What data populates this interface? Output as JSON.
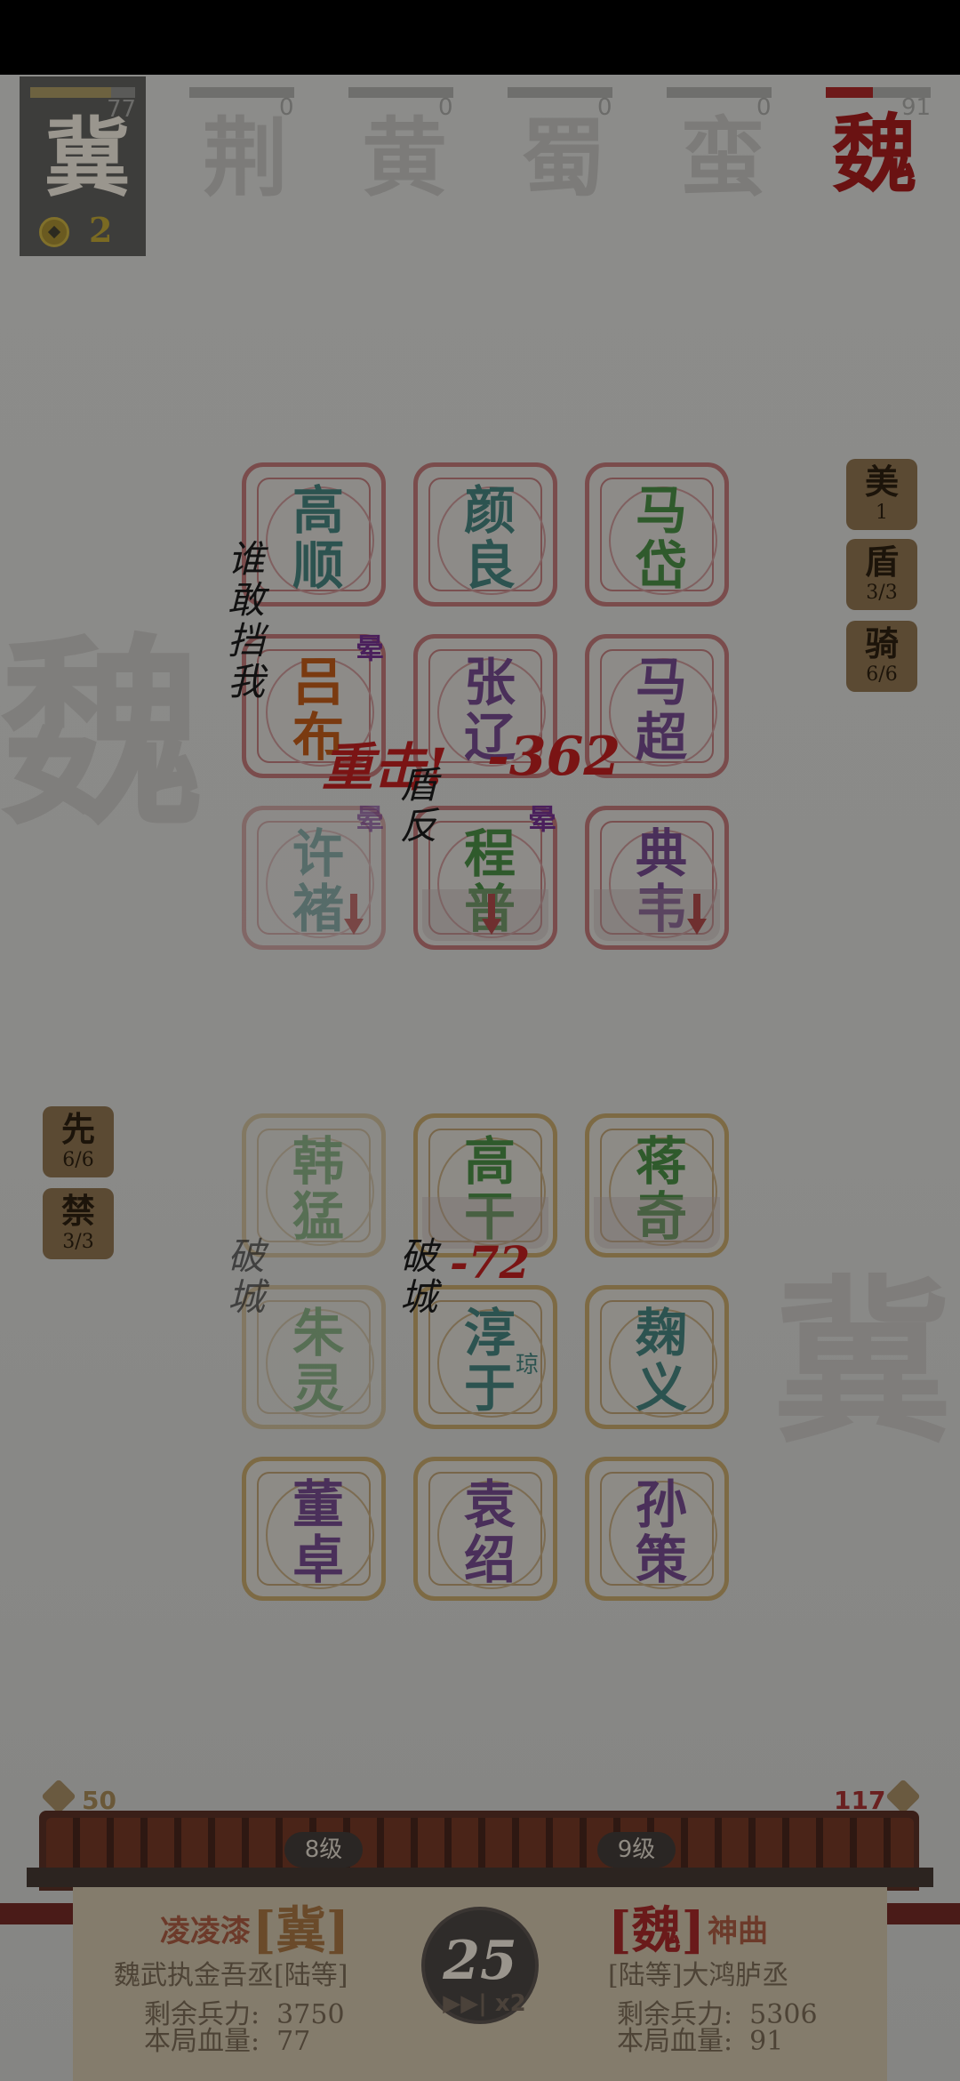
{
  "factions": {
    "active": {
      "name": "冀",
      "hp": "77",
      "hp_fraction": 0.77,
      "coins": "2"
    },
    "others": [
      {
        "name": "荆",
        "hp": "0"
      },
      {
        "name": "黄",
        "hp": "0"
      },
      {
        "name": "蜀",
        "hp": "0"
      },
      {
        "name": "蛮",
        "hp": "0"
      },
      {
        "name": "魏",
        "hp": "91",
        "hp_fraction": 0.45
      }
    ]
  },
  "enemy_board": {
    "rows": [
      [
        "高\n顺",
        "颜\n良",
        "马\n岱"
      ],
      [
        "吕\n布",
        "张\n辽",
        "马\n超"
      ],
      [
        "许\n褚",
        "程\n普",
        "典\n韦"
      ]
    ]
  },
  "ally_board": {
    "rows": [
      [
        "韩\n猛",
        "高\n干",
        "蒋\n奇"
      ],
      [
        "朱\n灵",
        "淳\n于",
        "麹\n义"
      ],
      [
        "董\n卓",
        "袁\n绍",
        "孙\n策"
      ]
    ],
    "tag_chun": "琼"
  },
  "enemy_badges": [
    {
      "title": "美",
      "value": "1"
    },
    {
      "title": "盾",
      "value": "3/3"
    },
    {
      "title": "骑",
      "value": "6/6"
    }
  ],
  "ally_badges": [
    {
      "title": "先",
      "value": "6/6"
    },
    {
      "title": "禁",
      "value": "3/3"
    }
  ],
  "effects": {
    "taunt_text": "谁敢挡我",
    "dizzy": "晕",
    "crit_text": "重击!",
    "crit_damage": "-362",
    "shield_break": "盾反",
    "city_break": "破城",
    "ally_damage": "-72"
  },
  "watermarks": {
    "enemy": "魏",
    "ally": "冀"
  },
  "bottom": {
    "left_troops": "50",
    "right_troops": "117",
    "left_level": "8级",
    "right_level": "9级",
    "left_player": "凌凌漆",
    "left_faction": "[冀]",
    "left_title": "魏武执金吾丞[陆等]",
    "left_remaining": "剩余兵力:  3750",
    "left_hp": "本局血量:  77",
    "right_faction": "[魏]",
    "right_player": "神曲",
    "right_title": "[陆等]大鸿胪丞",
    "right_remaining": "剩余兵力:  5306",
    "right_hp": "本局血量:  91",
    "turn": "25",
    "speed": "▶▶| x2"
  },
  "colors": {
    "enemy_border": "#7a4c4c",
    "ally_border": "#7d6a44",
    "green_name": "#2f5a2c",
    "purple_name": "#4a2f5a",
    "orange_name": "#7a3a10",
    "teal_name": "#2c5350",
    "damage_red": "#7a1414"
  }
}
